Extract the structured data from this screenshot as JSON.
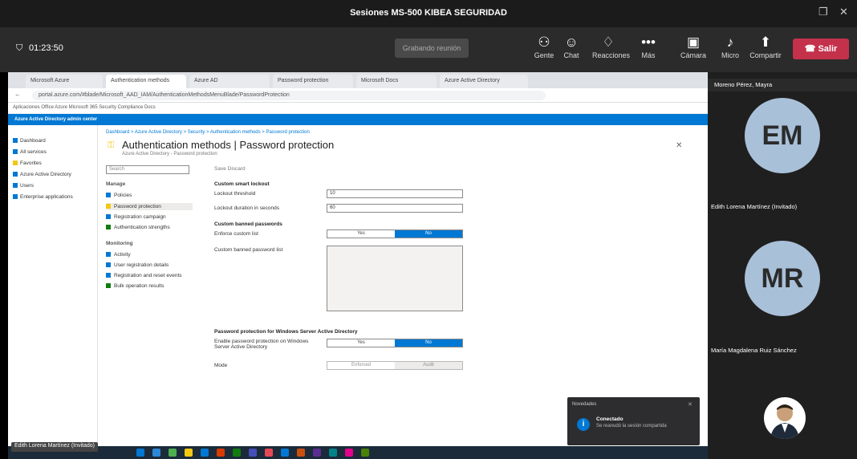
{
  "window": {
    "title": "Sesiones MS-500 KIBEA SEGURIDAD"
  },
  "meeting": {
    "timer": "01:23:50",
    "record_label": "Grabando reunión",
    "buttons": [
      {
        "icon": "people-icon",
        "label": "Gente"
      },
      {
        "icon": "chat-icon",
        "label": "Chat"
      },
      {
        "icon": "reactions-icon",
        "label": "Reacciones"
      },
      {
        "icon": "more-icon",
        "label": "Más"
      },
      {
        "icon": "camera-icon",
        "label": "Cámara"
      },
      {
        "icon": "mic-icon",
        "label": "Micro"
      },
      {
        "icon": "share-icon",
        "label": "Compartir"
      }
    ],
    "leave_label": "Salir"
  },
  "browser": {
    "tabs": [
      "Microsoft Azure",
      "Authentication methods",
      "Azure AD",
      "Password protection",
      "Microsoft Docs",
      "Azure Active Directory"
    ],
    "url": "portal.azure.com/#blade/Microsoft_AAD_IAM/AuthenticationMethodsMenuBlade/PasswordProtection",
    "bookmarks": "Aplicaciones   Office   Azure   Microsoft 365   Security   Compliance   Docs"
  },
  "azure": {
    "header": "Azure Active Directory admin center",
    "left_nav": [
      "Dashboard",
      "All services",
      "Favorites",
      "Azure Active Directory",
      "Users",
      "Enterprise applications"
    ],
    "breadcrumb": "Dashboard > Azure Active Directory > Security > Authentication methods > Password protection",
    "title": "Authentication methods | Password protection",
    "subtitle": "Azure Active Directory - Password protection",
    "search_placeholder": "Search",
    "cmd": "Save   Discard",
    "submenu": {
      "manage_header": "Manage",
      "manage": [
        "Policies",
        "Password protection",
        "Registration campaign",
        "Authentication strengths"
      ],
      "monitor_header": "Monitoring",
      "monitor": [
        "Activity",
        "User registration details",
        "Registration and reset events",
        "Bulk operation results"
      ]
    },
    "form": {
      "lockout_header": "Custom smart lockout",
      "lockout_threshold_label": "Lockout threshold",
      "lockout_threshold_value": "10",
      "lockout_duration_label": "Lockout duration in seconds",
      "lockout_duration_value": "60",
      "banned_header": "Custom banned passwords",
      "enforce_label": "Enforce custom list",
      "yes": "Yes",
      "no": "No",
      "banned_list_label": "Custom banned password list",
      "onprem_header": "Password protection for Windows Server Active Directory",
      "onprem_enable_label": "Enable password protection on Windows Server Active Directory",
      "mode_label": "Mode",
      "enforced": "Enforced",
      "audit": "Audit"
    }
  },
  "participants": {
    "presenter": "Moreno Pérez, Mayra",
    "people": [
      {
        "initials": "EM",
        "name": "Edith Lorena Martínez (Invitado)"
      },
      {
        "initials": "MR",
        "name": "María Magdalena Ruiz Sánchez"
      }
    ],
    "avatar_color": "#a9c0d9"
  },
  "toast": {
    "app": "Novedades",
    "title": "Conectado",
    "text": "Se reanudó la sesión compartida"
  },
  "taskbar": {
    "name_badge": "Edith Lorena Martínez (Invitado)"
  }
}
